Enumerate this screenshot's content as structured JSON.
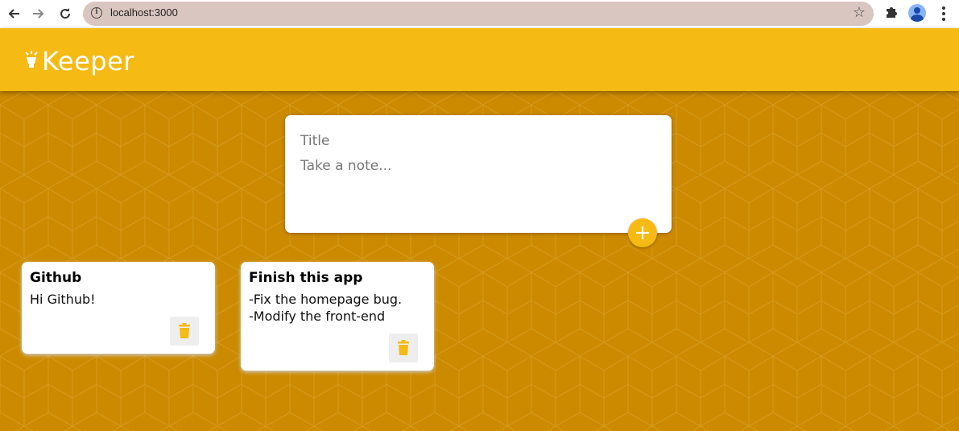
{
  "browser": {
    "url": "localhost:3000"
  },
  "header": {
    "title": "Keeper"
  },
  "create_note": {
    "title_placeholder": "Title",
    "content_placeholder": "Take a note..."
  },
  "notes": [
    {
      "title": "Github",
      "content": "Hi Github!"
    },
    {
      "title": "Finish this app",
      "content": "-Fix the homepage bug.\n-Modify the front-end"
    }
  ],
  "colors": {
    "accent": "#f5ba13",
    "background": "#cc8a00"
  },
  "icons": {
    "add": "plus-icon",
    "delete": "trash-icon",
    "logo": "lamp-icon"
  }
}
